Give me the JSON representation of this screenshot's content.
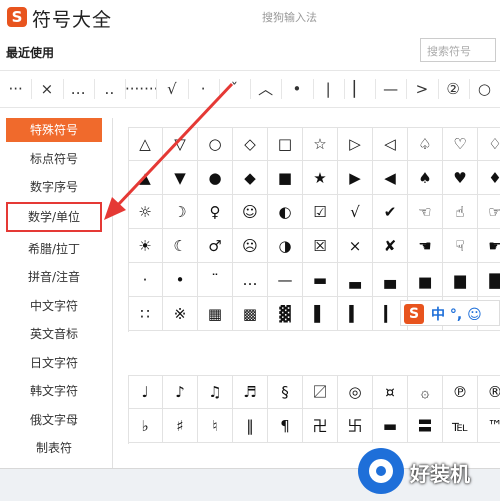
{
  "app": {
    "logo_letter": "S",
    "title": "符号大全",
    "subtitle": "搜狗输入法"
  },
  "recent": {
    "label": "最近使用",
    "search_placeholder": "搜索符号",
    "symbols": [
      "···",
      "×",
      "…",
      "‥",
      "·······",
      "√",
      "·",
      "ˇ",
      "︿",
      "•",
      "|",
      "▏",
      "—",
      ">",
      "②",
      "○"
    ]
  },
  "sidebar": {
    "items": [
      {
        "label": "特殊符号"
      },
      {
        "label": "标点符号"
      },
      {
        "label": "数字序号"
      },
      {
        "label": "数学/单位"
      },
      {
        "label": "希腊/拉丁"
      },
      {
        "label": "拼音/注音"
      },
      {
        "label": "中文字符"
      },
      {
        "label": "英文音标"
      },
      {
        "label": "日文字符"
      },
      {
        "label": "韩文字符"
      },
      {
        "label": "俄文字母"
      },
      {
        "label": "制表符"
      }
    ]
  },
  "grid_top": [
    [
      "△",
      "▽",
      "○",
      "◇",
      "□",
      "☆",
      "▷",
      "◁",
      "♤",
      "♡",
      "♢"
    ],
    [
      "▲",
      "▼",
      "●",
      "◆",
      "■",
      "★",
      "▶",
      "◀",
      "♠",
      "♥",
      "♦"
    ],
    [
      "☼",
      "☽",
      "♀",
      "☺",
      "◐",
      "☑",
      "√",
      "✔",
      "☜",
      "☝",
      "☞"
    ],
    [
      "☀",
      "☾",
      "♂",
      "☹",
      "◑",
      "☒",
      "×",
      "✘",
      "☚",
      "☟",
      "☛"
    ],
    [
      "·",
      "•",
      "¨",
      "…",
      "—",
      "▬",
      "▃",
      "▄",
      "▅",
      "▆",
      "▇"
    ],
    [
      "∷",
      "※",
      "▦",
      "▩",
      "▓",
      "▌",
      "▍",
      "▎",
      "▏",
      "",
      ""
    ]
  ],
  "grid_bottom": [
    [
      "♩",
      "♪",
      "♫",
      "♬",
      "§",
      "〼",
      "◎",
      "¤",
      "۞",
      "℗",
      "®"
    ],
    [
      "♭",
      "♯",
      "♮",
      "‖",
      "¶",
      "卍",
      "卐",
      "▬",
      "〓",
      "℡",
      "™"
    ]
  ],
  "ime": {
    "logo_letter": "S",
    "text": "中 °, ☺"
  },
  "watermark": {
    "text": "好装机"
  },
  "colors": {
    "accent": "#f06a2c",
    "highlight_box": "#e53935",
    "arrow": "#e53935"
  }
}
